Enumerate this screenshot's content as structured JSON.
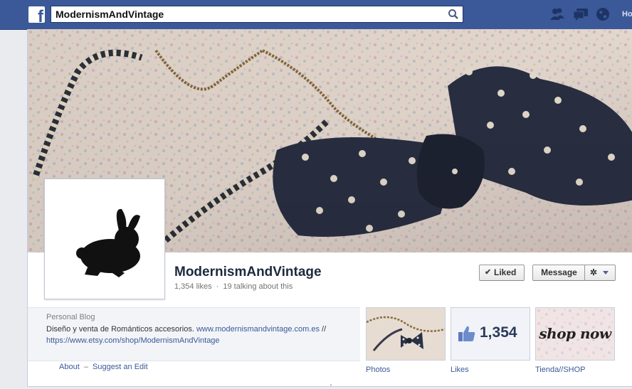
{
  "search": {
    "value": "ModernismAndVintage"
  },
  "nav": {
    "home_label": "Ho"
  },
  "page": {
    "name": "ModernismAndVintage",
    "likes_text": "1,354 likes",
    "separator": "·",
    "talking_text": "19 talking about this"
  },
  "buttons": {
    "liked_label": "Liked",
    "message_label": "Message"
  },
  "about": {
    "category": "Personal Blog",
    "description": "Diseño y venta de Románticos accesorios.",
    "link1": "www.modernismandvintage.com.es",
    "slashes": "//",
    "link2": "https://www.etsy.com/shop/ModernismAndVintage",
    "about_link": "About",
    "dash": "–",
    "suggest_link": "Suggest an Edit"
  },
  "apps": [
    {
      "label": "Photos"
    },
    {
      "label": "Likes",
      "count": "1,354"
    },
    {
      "label": "Tienda//SHOP",
      "tile_text": "shop now"
    }
  ],
  "colors": {
    "brand_blue": "#3b5998",
    "topbar_border": "#29487d",
    "link": "#3b5998"
  }
}
